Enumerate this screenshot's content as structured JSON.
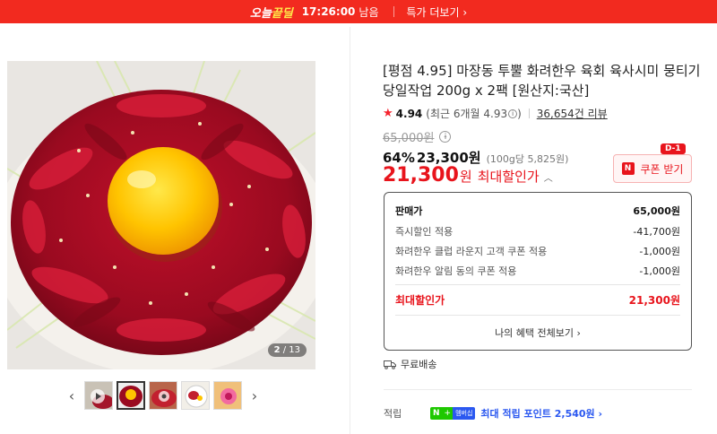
{
  "topbar": {
    "brand_prefix": "오늘",
    "brand_highlight": "끝딜",
    "timer": "17:26:00",
    "timer_suffix": "남음",
    "more_link": "특가 더보기 ›"
  },
  "gallery": {
    "current": "2",
    "total": "/ 13",
    "prev_icon": "chevron-left-icon",
    "next_icon": "chevron-right-icon"
  },
  "product": {
    "title": "[평점 4.95] 마장동 투뿔 화려한우 육회 육사시미 뭉티기 당일작업 200g x 2팩 [원산지:국산]",
    "rating": "4.94",
    "rating_recent": "(최근 6개월 4.93",
    "rating_recent_close": ")",
    "reviews": "36,654건 리뷰",
    "original_price": "65,000원",
    "discount_pct": "64%",
    "sale_price": "23,300원",
    "unit_price": "(100g당 5,825원)",
    "max_price": "21,300",
    "max_won": "원",
    "max_label": "최대할인가",
    "coupon_label": "쿠폰 받기",
    "coupon_badge": "N",
    "dday": "D-1"
  },
  "breakdown": {
    "rows": [
      {
        "label": "판매가",
        "amount": "65,000원"
      },
      {
        "label": "즉시할인 적용",
        "amount": "-41,700원"
      },
      {
        "label": "화려한우 클럽 라운지 고객 쿠폰 적용",
        "amount": "-1,000원"
      },
      {
        "label": "화려한우 알림 동의 쿠폰 적용",
        "amount": "-1,000원"
      }
    ],
    "final_label": "최대할인가",
    "final_amount": "21,300원",
    "all_benefits": "나의 혜택 전체보기 ›"
  },
  "shipping": {
    "label": "무료배송"
  },
  "points": {
    "label": "적립",
    "badge_n": "N",
    "badge_plus": "+",
    "badge_member": "멤버십",
    "text": "최대 적립 포인트 2,540원 ›"
  },
  "colors": {
    "accent_red": "#e8141c",
    "topbar_red": "#f22a1f",
    "naver_green": "#1ec800",
    "link_blue": "#2b58f0"
  }
}
